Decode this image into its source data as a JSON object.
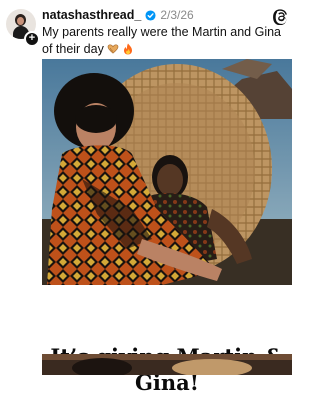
{
  "post": {
    "username": "natashasthread_",
    "date": "2/3/26",
    "caption": "My parents really were the Martin and Gina of their day",
    "caption_emojis": [
      "heart-hands",
      "fire"
    ]
  },
  "meme": {
    "line1": "It’s giving Martin &",
    "line2": "Gina!"
  },
  "colors": {
    "verified": "#0095f6",
    "date": "#8a8a8a"
  },
  "icons": [
    "avatar",
    "follow-plus-icon",
    "verified-badge-icon",
    "threads-logo-icon",
    "heart-hands-emoji",
    "fire-emoji"
  ]
}
